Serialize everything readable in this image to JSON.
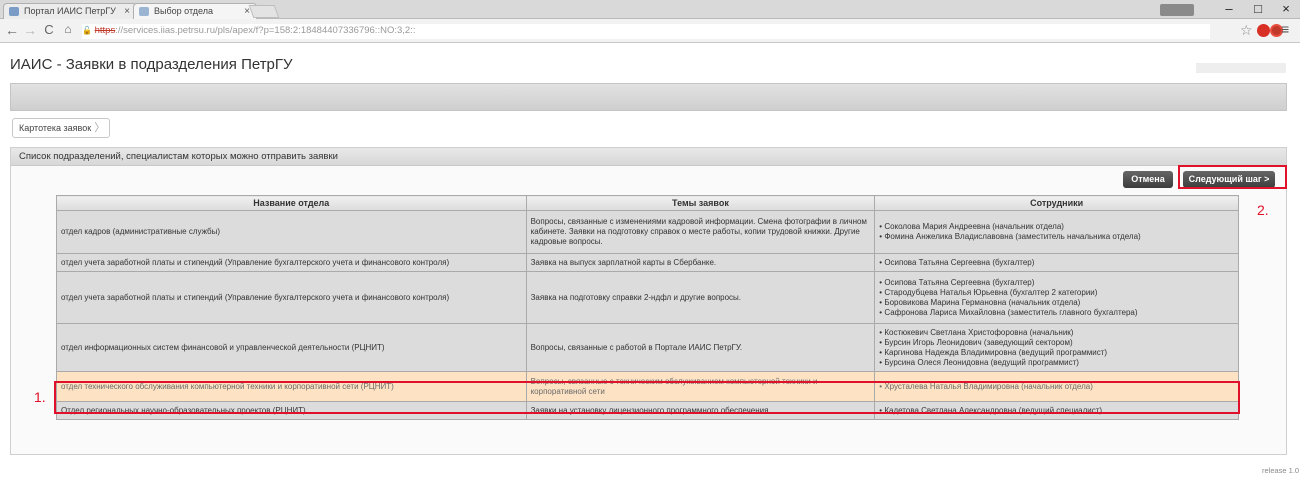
{
  "browser": {
    "tabs": [
      {
        "label": "Портал ИАИС ПетрГУ",
        "active": false
      },
      {
        "label": "Выбор отдела",
        "active": true
      }
    ],
    "url": {
      "scheme": "https",
      "rest": "://services.iias.petrsu.ru/pls/apex/f?p=158:2:18484407336796::NO:3,2::",
      "host": "services.iias.petrsu.ru"
    },
    "controls": {
      "minimize": "–",
      "maximize": "□",
      "close": "×"
    }
  },
  "page": {
    "title": "ИАИС - Заявки в подразделения ПетрГУ",
    "breadcrumb": "Картотека заявок",
    "region_title": "Список подразделений, специалистам которых можно отправить заявки",
    "buttons": {
      "cancel": "Отмена",
      "next": "Следующий шаг >"
    },
    "callouts": {
      "first": "1.",
      "second": "2."
    },
    "release": "release 1.0"
  },
  "table": {
    "headers": [
      "Название отдела",
      "Темы заявок",
      "Сотрудники"
    ],
    "rows": [
      {
        "dept": "отдел кадров (административные службы)",
        "topics": "Вопросы, связанные с изменениями кадровой информации. Смена фотографии в личном кабинете. Заявки на подготовку справок о месте работы, копии трудовой книжки. Другие кадровые вопросы.",
        "staff": [
          "Соколова Мария Андреевна (начальник отдела)",
          "Фомина Анжелика Владиславовна (заместитель начальника отдела)"
        ],
        "selected": false
      },
      {
        "dept": "отдел учета заработной платы и стипендий (Управление бухгалтерского учета и финансового контроля)",
        "topics": "Заявка на выпуск зарплатной карты в Сбербанке.",
        "staff": [
          "Осипова Татьяна Сергеевна (бухгалтер)"
        ],
        "selected": false
      },
      {
        "dept": "отдел учета заработной платы и стипендий (Управление бухгалтерского учета и финансового контроля)",
        "topics": "Заявка на подготовку справки 2-ндфл и другие вопросы.",
        "staff": [
          "Осипова Татьяна Сергеевна (бухгалтер)",
          "Стародубцева Наталья Юрьевна (бухгалтер 2 категории)",
          "Боровикова Марина Германовна (начальник отдела)",
          "Сафронова Лариса Михайловна (заместитель главного бухгалтера)"
        ],
        "selected": false
      },
      {
        "dept": "отдел информационных систем финансовой и управленческой деятельности (РЦНИТ)",
        "topics": "Вопросы, связанные с работой в Портале ИАИС ПетрГУ.",
        "staff": [
          "Костюкевич Светлана Христофоровна (начальник)",
          "Бурсин Игорь Леонидович (заведующий сектором)",
          "Каргинова Надежда Владимировна (ведущий программист)",
          "Бурсина Олеся Леонидовна (ведущий программист)"
        ],
        "selected": false
      },
      {
        "dept": "отдел технического обслуживания компьютерной техники и корпоративной сети (РЦНИТ)",
        "topics": "Вопросы, связанные с техническим обслуживанием компьютерной техники и корпоративной сети",
        "staff": [
          "Хрусталева Наталья Владимировна (начальник отдела)"
        ],
        "selected": true
      },
      {
        "dept": "Отдел региональных научно-образовательных проектов (РЦНИТ)",
        "topics": "Заявки на установку лицензионного программного обеспечения",
        "staff": [
          "Кадетова Светлана Александровна (ведущий специалист)"
        ],
        "selected": false
      }
    ]
  },
  "colors": {
    "highlight": "#e0112a",
    "selected_row": "#fde3c4"
  }
}
